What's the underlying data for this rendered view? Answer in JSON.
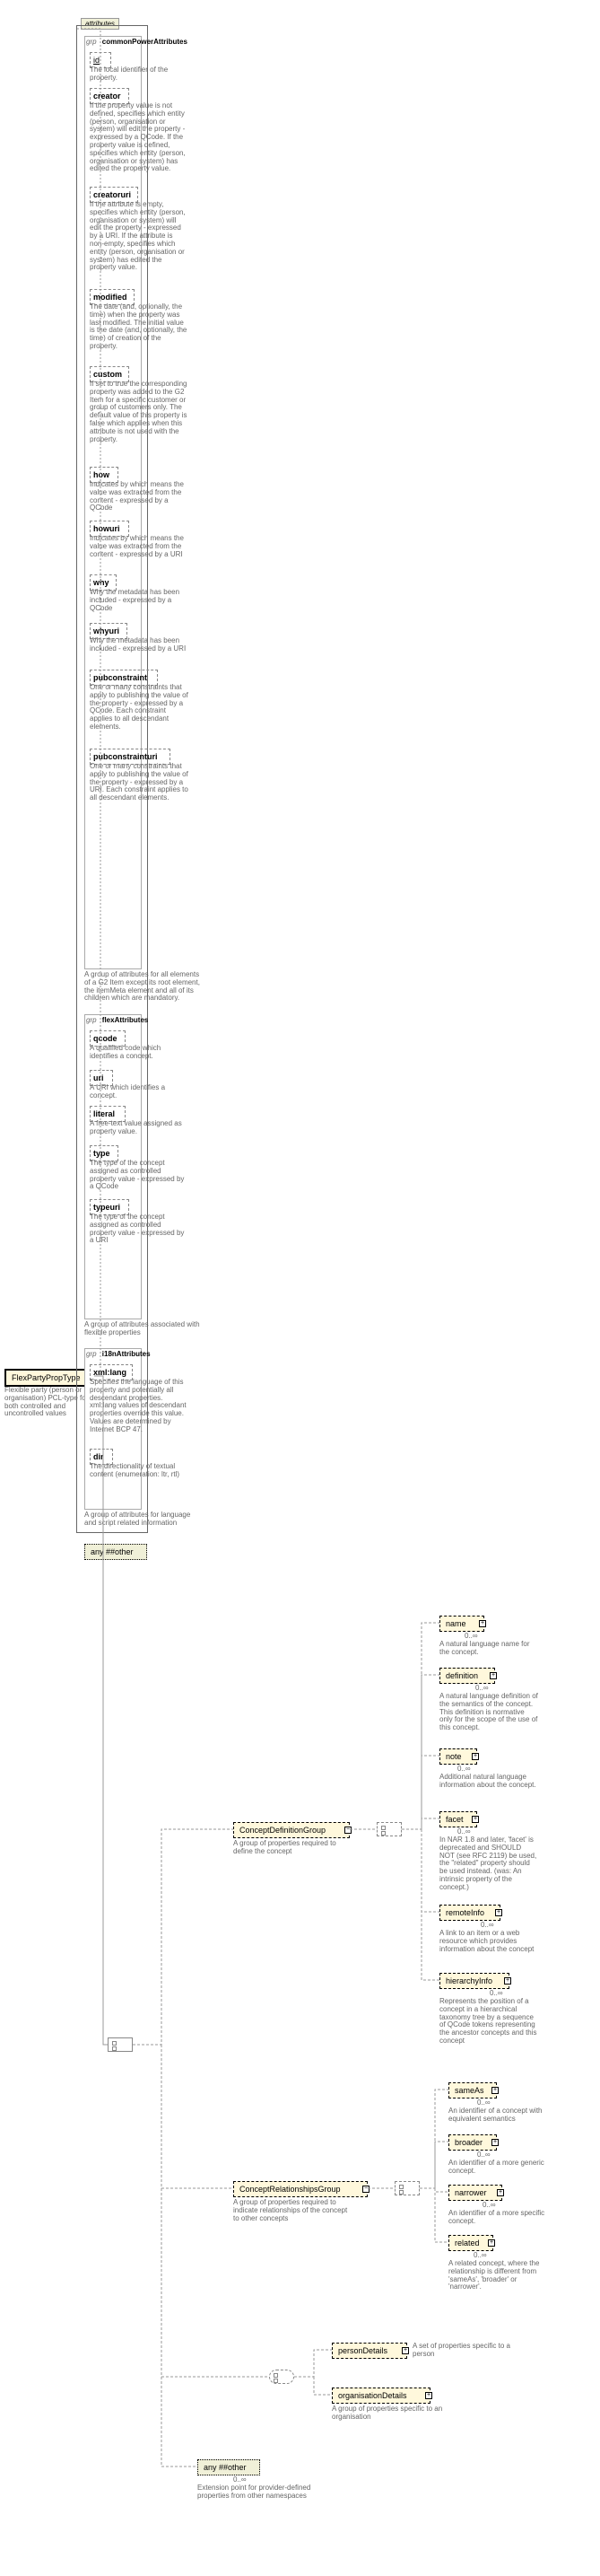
{
  "root": {
    "name": "FlexPartyPropType",
    "desc": "Flexible party (person or organisation) PCL-type for both controlled and uncontrolled values"
  },
  "attrPanel": {
    "label": "attributes"
  },
  "groups": {
    "common": {
      "label": "grp",
      "name": "commonPowerAttributes",
      "desc": "A group of attributes for all elements of a G2 Item except its root element, the itemMeta element and all of its children which are mandatory.",
      "attrs": [
        {
          "name": "id",
          "desc": "The local identifier of the property."
        },
        {
          "name": "creator",
          "desc": "If the property value is not defined, specifies which entity (person, organisation or system) will edit the property - expressed by a QCode. If the property value is defined, specifies which entity (person, organisation or system) has edited the property value."
        },
        {
          "name": "creatoruri",
          "desc": "If the attribute is empty, specifies which entity (person, organisation or system) will edit the property - expressed by a URI. If the attribute is non-empty, specifies which entity (person, organisation or system) has edited the property value."
        },
        {
          "name": "modified",
          "desc": "The date (and, optionally, the time) when the property was last modified. The initial value is the date (and, optionally, the time) of creation of the property."
        },
        {
          "name": "custom",
          "desc": "If set to true the corresponding property was added to the G2 Item for a specific customer or group of customers only. The default value of this property is false which applies when this attribute is not used with the property."
        },
        {
          "name": "how",
          "desc": "Indicates by which means the value was extracted from the content - expressed by a QCode"
        },
        {
          "name": "howuri",
          "desc": "Indicates by which means the value was extracted from the content - expressed by a URI"
        },
        {
          "name": "why",
          "desc": "Why the metadata has been included - expressed by a QCode"
        },
        {
          "name": "whyuri",
          "desc": "Why the metadata has been included - expressed by a URI"
        },
        {
          "name": "pubconstraint",
          "desc": "One or many constraints that apply to publishing the value of the property - expressed by a QCode. Each constraint applies to all descendant elements."
        },
        {
          "name": "pubconstrainturi",
          "desc": "One or many constraints that apply to publishing the value of the property - expressed by a URI. Each constraint applies to all descendant elements."
        }
      ]
    },
    "flex": {
      "label": "grp",
      "name": "flexAttributes",
      "desc": "A group of attributes associated with flexible properties",
      "attrs": [
        {
          "name": "qcode",
          "desc": "A qualified code which identifies a concept."
        },
        {
          "name": "uri",
          "desc": "A URI which identifies a concept."
        },
        {
          "name": "literal",
          "desc": "A free-text value assigned as property value."
        },
        {
          "name": "type",
          "desc": "The type of the concept assigned as controlled property value - expressed by a QCode"
        },
        {
          "name": "typeuri",
          "desc": "The type of the concept assigned as controlled property value - expressed by a URI"
        }
      ]
    },
    "i18n": {
      "label": "grp",
      "name": "i18nAttributes",
      "desc": "A group of attributes for language and script related information",
      "attrs": [
        {
          "name": "xml:lang",
          "desc": "Specifies the language of this property and potentially all descendant properties. xml:lang values of descendant properties override this value. Values are determined by Internet BCP 47."
        },
        {
          "name": "dir",
          "desc": "The directionality of textual content (enumeration: ltr, rtl)"
        }
      ]
    }
  },
  "anyOther": "any ##other",
  "cdg": {
    "name": "ConceptDefinitionGroup",
    "desc": "A group of properties required to define the concept",
    "children": [
      {
        "name": "name",
        "desc": "A natural language name for the concept."
      },
      {
        "name": "definition",
        "desc": "A natural language definition of the semantics of the concept. This definition is normative only for the scope of the use of this concept."
      },
      {
        "name": "note",
        "desc": "Additional natural language information about the concept."
      },
      {
        "name": "facet",
        "desc": "In NAR 1.8 and later, 'facet' is deprecated and SHOULD NOT (see RFC 2119) be used, the \"related\" property should be used instead. (was: An intrinsic property of the concept.)"
      },
      {
        "name": "remoteInfo",
        "desc": "A link to an item or a web resource which provides information about the concept"
      },
      {
        "name": "hierarchyInfo",
        "desc": "Represents the position of a concept in a hierarchical taxonomy tree by a sequence of QCode tokens representing the ancestor concepts and this concept"
      }
    ]
  },
  "crg": {
    "name": "ConceptRelationshipsGroup",
    "desc": "A group of properties required to indicate relationships of the concept to other concepts",
    "children": [
      {
        "name": "sameAs",
        "desc": "An identifier of a concept with equivalent semantics"
      },
      {
        "name": "broader",
        "desc": "An identifier of a more generic concept."
      },
      {
        "name": "narrower",
        "desc": "An identifier of a more specific concept."
      },
      {
        "name": "related",
        "desc": "A related concept, where the relationship is different from 'sameAs', 'broader' or 'narrower'."
      }
    ]
  },
  "choice": {
    "person": {
      "name": "personDetails",
      "desc": "A set of properties specific to a person"
    },
    "org": {
      "name": "organisationDetails",
      "desc": "A group of properties specific to an organisation"
    }
  },
  "ext": {
    "label": "any ##other",
    "desc": "Extension point for provider-defined properties from other namespaces"
  },
  "cardinality": "0..∞"
}
